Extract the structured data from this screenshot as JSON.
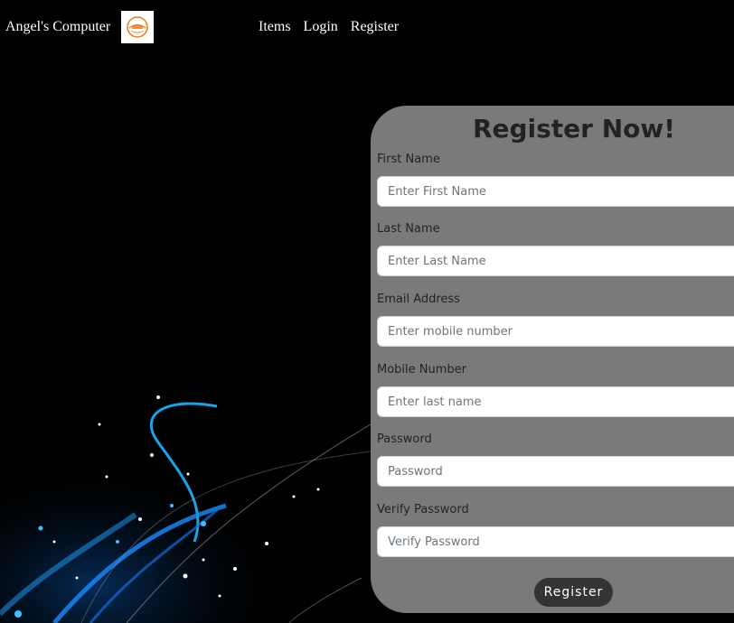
{
  "navbar": {
    "brand": "Angel's Computer",
    "logo_icon": "brand-logo-icon",
    "links": [
      "Items",
      "Login",
      "Register"
    ]
  },
  "form": {
    "title": "Register Now!",
    "fields": [
      {
        "label": "First Name",
        "placeholder": "Enter First Name",
        "type": "text"
      },
      {
        "label": "Last Name",
        "placeholder": "Enter Last Name",
        "type": "text"
      },
      {
        "label": "Email Address",
        "placeholder": "Enter mobile number",
        "type": "text"
      },
      {
        "label": "Mobile Number",
        "placeholder": "Enter last name",
        "type": "text"
      },
      {
        "label": "Password",
        "placeholder": "Password",
        "type": "password"
      },
      {
        "label": "Verify Password",
        "placeholder": "Verify Password",
        "type": "password"
      }
    ],
    "submit_label": "Register"
  },
  "colors": {
    "page_background": "#000000",
    "card_background": "#7a7a7a",
    "button_background": "#343434",
    "accent_glow": "#1e90ff",
    "logo_orange": "#f07a1a"
  }
}
